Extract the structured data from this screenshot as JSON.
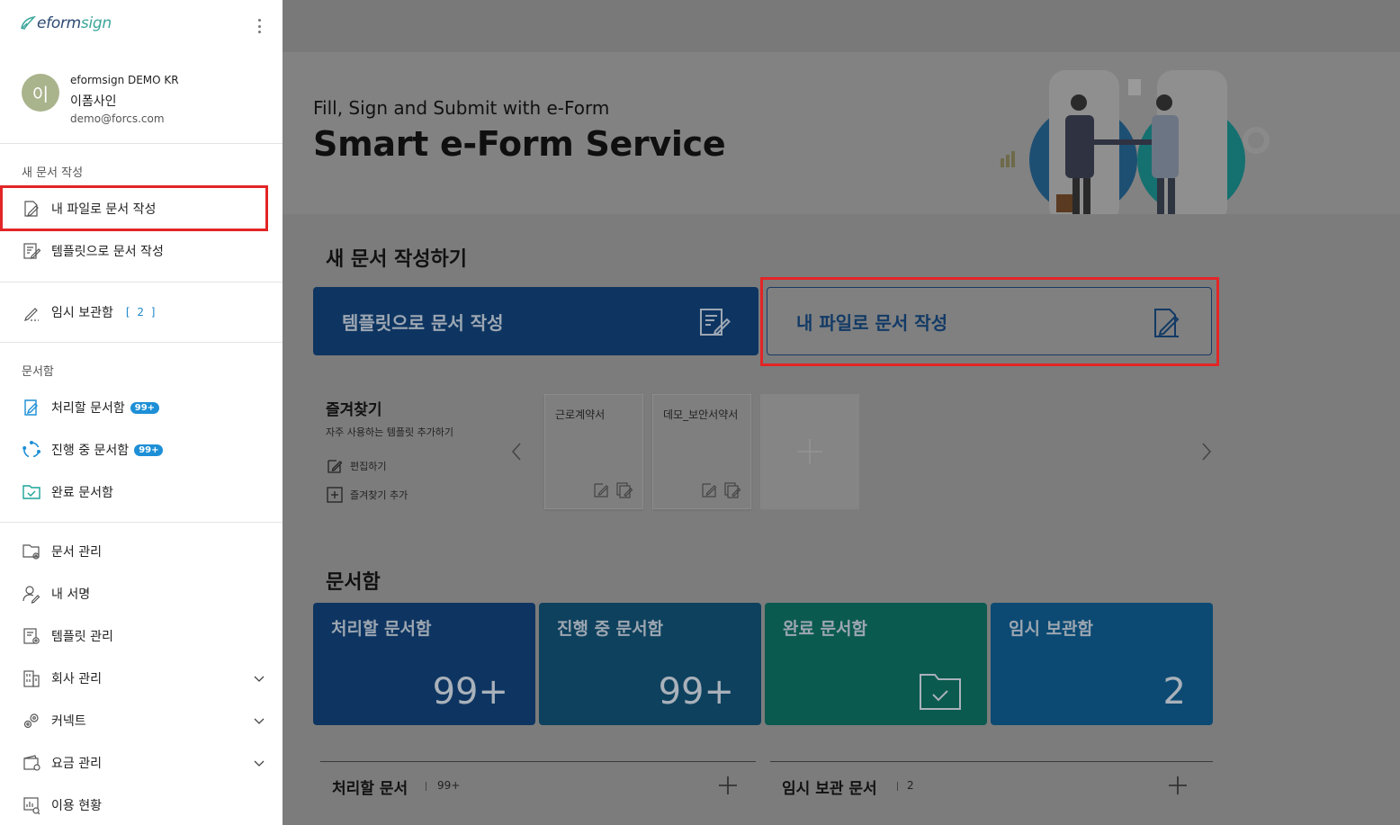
{
  "sidebar": {
    "logo": {
      "prefix": "eform",
      "suffix": "sign"
    },
    "profile": {
      "avatar_initial": "이",
      "company": "eformsign DEMO KR",
      "name": "이폼사인",
      "email": "demo@forcs.com"
    },
    "sections": {
      "new_doc": "새 문서 작성",
      "docbox": "문서함"
    },
    "items": {
      "my_file": "내 파일로 문서 작성",
      "template": "템플릿으로 문서 작성",
      "temp_storage": "임시 보관함",
      "temp_count": "[ 2 ]",
      "to_process": "처리할 문서함",
      "to_process_badge": "99+",
      "in_progress": "진행 중 문서함",
      "in_progress_badge": "99+",
      "completed": "완료 문서함",
      "doc_manage": "문서 관리",
      "my_signature": "내 서명",
      "template_manage": "템플릿 관리",
      "company_manage": "회사 관리",
      "connect": "커넥트",
      "billing": "요금 관리",
      "usage": "이용 현황"
    }
  },
  "hero": {
    "subtitle": "Fill, Sign and Submit with e-Form",
    "title": "Smart e-Form Service"
  },
  "new_doc": {
    "heading": "새 문서 작성하기",
    "template_button": "템플릿으로 문서 작성",
    "myfile_button": "내 파일로 문서 작성"
  },
  "favorites": {
    "title": "즐겨찾기",
    "subtitle": "자주 사용하는 템플릿 추가하기",
    "edit": "편집하기",
    "add": "즐겨찾기 추가",
    "cards": [
      "근로계약서",
      "데모_보안서약서"
    ]
  },
  "docbox": {
    "heading": "문서함",
    "boxes": {
      "to_process": {
        "title": "처리할 문서함",
        "value": "99+"
      },
      "in_progress": {
        "title": "진행 중 문서함",
        "value": "99+"
      },
      "completed": {
        "title": "완료 문서함"
      },
      "temp": {
        "title": "임시 보관함",
        "value": "2"
      }
    }
  },
  "lists": {
    "to_process": {
      "title": "처리할 문서",
      "count": "99+"
    },
    "temp": {
      "title": "임시 보관 문서",
      "count": "2"
    }
  },
  "colors": {
    "highlight": "#e32526",
    "navy": "#0e3561",
    "badge": "#1d8fd6"
  }
}
